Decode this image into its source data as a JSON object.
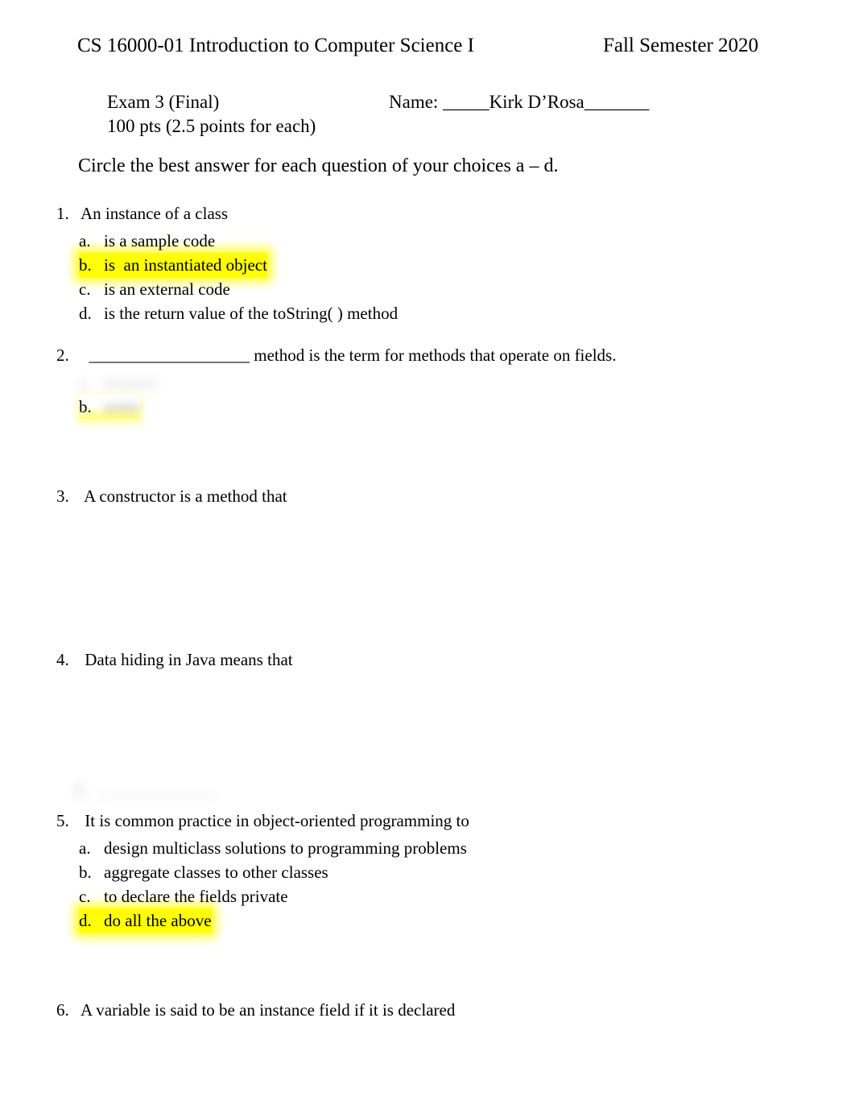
{
  "header": {
    "course_title": "CS 16000-01 Introduction to Computer Science I",
    "term": "Fall Semester 2020"
  },
  "exam_meta": {
    "exam_label": "Exam 3 (Final)",
    "name_label": "Name: ",
    "name_value": "_____Kirk D’Rosa_______",
    "points_line": "100 pts (2.5 points for each)"
  },
  "instruction": "Circle the best answer for each question of your choices a – d.",
  "questions": [
    {
      "number": "1.",
      "text": "An instance of a class",
      "options": [
        {
          "letter": "a.",
          "text": "is a sample code",
          "highlighted": false,
          "redacted": false
        },
        {
          "letter": "b.",
          "text": "is  an instantiated object",
          "highlighted": true,
          "redacted": false
        },
        {
          "letter": "c.",
          "text": "is an external code",
          "highlighted": false,
          "redacted": false
        },
        {
          "letter": "d.",
          "text": "is the return value of the toString( ) method",
          "highlighted": false,
          "redacted": false
        }
      ]
    },
    {
      "number": "2.",
      "text": "  ___________________ method is the term for methods that operate on fields.",
      "options": [
        {
          "letter": "a.",
          "text": "mutator",
          "highlighted": false,
          "redacted": true,
          "letter_redacted": true
        },
        {
          "letter": "b.",
          "text": "setter",
          "highlighted": false,
          "redacted": true,
          "letter_redacted": false,
          "highlight_ghost": true
        }
      ]
    },
    {
      "number": "3.",
      "text": " A constructor is a method that",
      "options": []
    },
    {
      "number": "4.",
      "text": " Data hiding in Java means that",
      "options": []
    },
    {
      "number": "5.",
      "text": " It is common practice in object-oriented programming to",
      "options": [
        {
          "letter": "a.",
          "text": "design multiclass solutions to programming problems",
          "highlighted": false,
          "redacted": false
        },
        {
          "letter": "b.",
          "text": "aggregate classes to other classes",
          "highlighted": false,
          "redacted": false
        },
        {
          "letter": "c.",
          "text": "to declare the fields private",
          "highlighted": false,
          "redacted": false
        },
        {
          "letter": "d.",
          "text": "do all the above",
          "highlighted": true,
          "redacted": false
        }
      ]
    },
    {
      "number": "6.",
      "text": "A variable is said to be an instance field if it is declared",
      "options": []
    }
  ],
  "ghost_remnant": {
    "text": "d.   ______________"
  }
}
